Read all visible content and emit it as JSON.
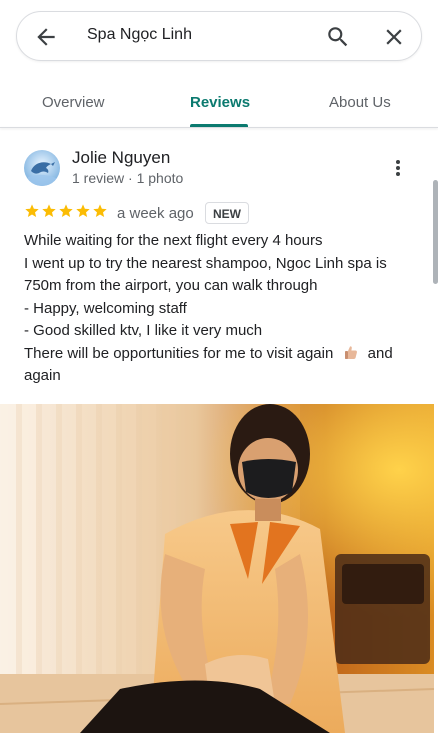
{
  "search": {
    "query": "Spa Ngọc Linh"
  },
  "tabs": [
    {
      "label": "Overview",
      "active": false
    },
    {
      "label": "Reviews",
      "active": true
    },
    {
      "label": "About Us",
      "active": false
    }
  ],
  "review": {
    "author": "Jolie Nguyen",
    "meta": "1 review · 1 photo",
    "rating": 5,
    "age": "a week ago",
    "badge": "NEW",
    "lines": [
      "While waiting for the next flight every 4 hours",
      "I went up to try the nearest shampoo, Ngoc Linh spa is",
      "750m from the airport, you can walk through",
      "- Happy, welcoming staff",
      "- Good skilled ktv, I like it very much",
      "There will be opportunities for me to visit again",
      "and",
      "again"
    ]
  },
  "colors": {
    "accent": "#0b7a6f",
    "star": "#fbbc04"
  },
  "icons": [
    "back-arrow-icon",
    "search-icon",
    "close-icon",
    "more-vert-icon",
    "star-icon",
    "thumbs-up-emoji"
  ]
}
